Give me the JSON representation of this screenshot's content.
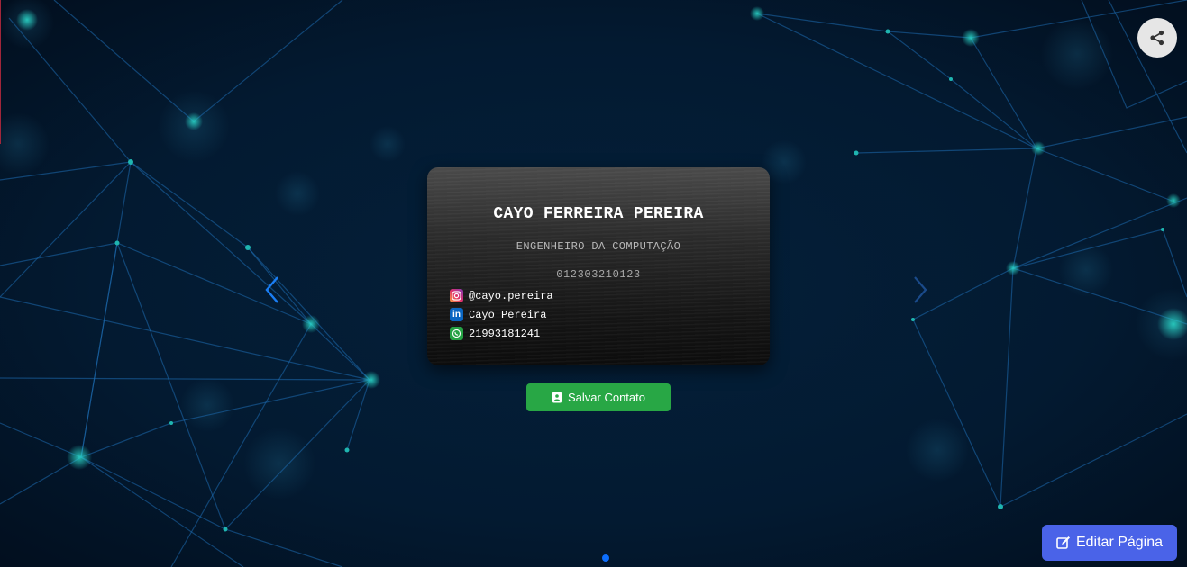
{
  "card": {
    "name": "CAYO FERREIRA PEREIRA",
    "title": "ENGENHEIRO DA COMPUTAÇÃO",
    "number": "012303210123",
    "contacts": [
      {
        "icon": "instagram-icon",
        "text": "@cayo.pereira"
      },
      {
        "icon": "linkedin-icon",
        "text": "Cayo Pereira"
      },
      {
        "icon": "whatsapp-icon",
        "text": "21993181241"
      }
    ]
  },
  "save_button": {
    "label": "Salvar Contato",
    "icon": "contact-card-icon",
    "color": "#28a745"
  },
  "edit_button": {
    "label": "Editar Página",
    "icon": "edit-icon",
    "color": "#4a63e8"
  },
  "share_button": {
    "icon": "share-icon"
  },
  "carousel": {
    "prev_icon": "chevron-left-icon",
    "next_icon": "chevron-right-icon",
    "active_dot_color": "#0d6efd"
  },
  "colors": {
    "background": "#03152a",
    "network_lines": "#1e6bb0",
    "network_nodes": "#1fb5b0"
  }
}
